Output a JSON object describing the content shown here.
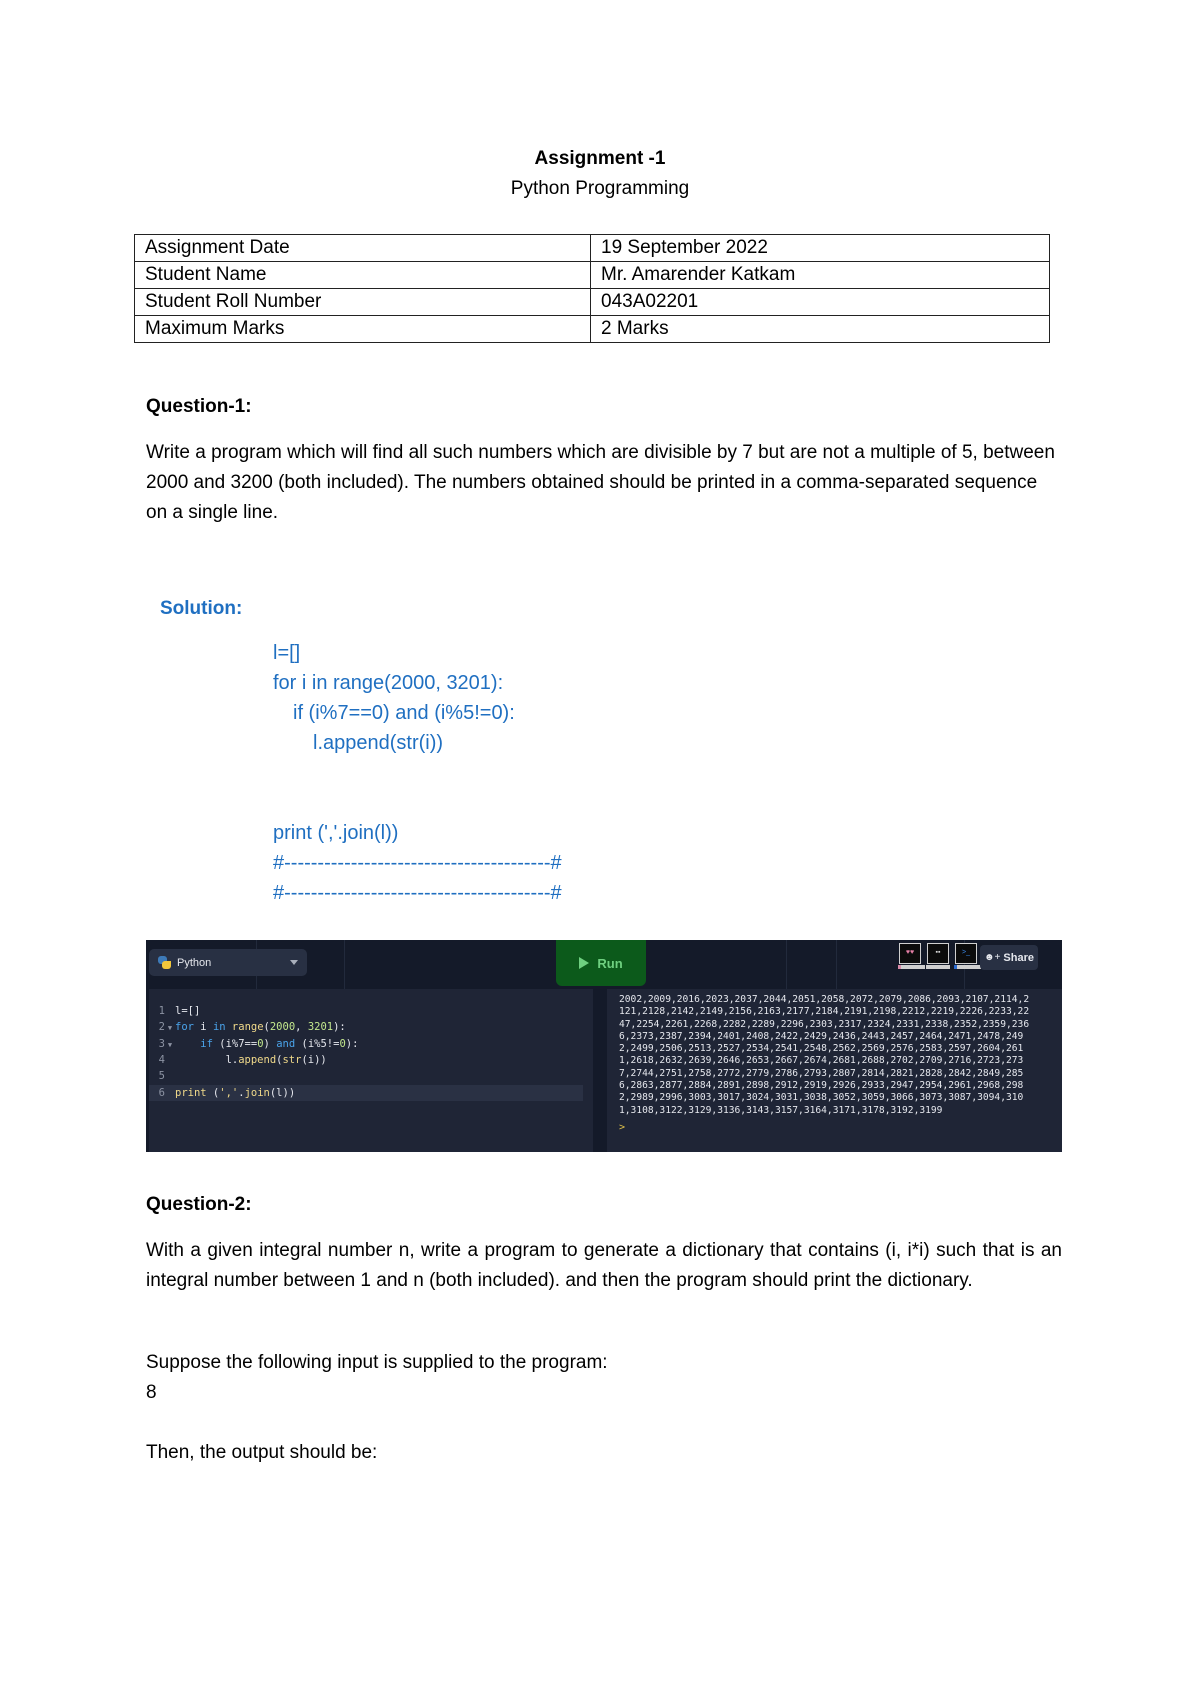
{
  "header": {
    "title": "Assignment -1",
    "subtitle": "Python Programming"
  },
  "info_table": [
    {
      "label": "Assignment Date",
      "value": "19 September 2022"
    },
    {
      "label": "Student Name",
      "value": "Mr. Amarender Katkam"
    },
    {
      "label": "Student Roll Number",
      "value": "043A02201"
    },
    {
      "label": "Maximum Marks",
      "value": "2 Marks"
    }
  ],
  "question1": {
    "heading": "Question-1:",
    "text": "Write a program which will find all such numbers which are divisible by 7 but are not a multiple of 5, between 2000 and 3200 (both included). The numbers obtained should be printed in a comma-separated sequence on a single line.",
    "solution_heading": "Solution:",
    "solution_lines": [
      "l=[]",
      "for i in range(2000, 3201):",
      "if (i%7==0) and (i%5!=0):",
      "l.append(str(i))",
      "print (','.join(l))",
      "#----------------------------------------#",
      "#----------------------------------------#"
    ]
  },
  "ide": {
    "language": "Python",
    "run_label": "Run",
    "share_label": "Share",
    "avatars": [
      {
        "name": "heart-eyes-avatar",
        "face": "♥♥"
      },
      {
        "name": "neutral-avatar",
        "face": "▪▪"
      },
      {
        "name": "prompt-avatar",
        "face": ">_"
      }
    ],
    "code": [
      {
        "n": "1",
        "fold": "",
        "tokens": [
          {
            "t": "l=[]",
            "c": "plain"
          }
        ]
      },
      {
        "n": "2",
        "fold": "▼",
        "tokens": [
          {
            "t": "for",
            "c": "kw"
          },
          {
            "t": " i ",
            "c": "plain"
          },
          {
            "t": "in",
            "c": "kw"
          },
          {
            "t": " ",
            "c": "plain"
          },
          {
            "t": "range",
            "c": "fn"
          },
          {
            "t": "(",
            "c": "op"
          },
          {
            "t": "2000",
            "c": "num"
          },
          {
            "t": ", ",
            "c": "op"
          },
          {
            "t": "3201",
            "c": "num"
          },
          {
            "t": "):",
            "c": "op"
          }
        ]
      },
      {
        "n": "3",
        "fold": "▼",
        "tokens": [
          {
            "t": "    ",
            "c": "plain"
          },
          {
            "t": "if",
            "c": "kw"
          },
          {
            "t": " (i%7==",
            "c": "plain"
          },
          {
            "t": "0",
            "c": "num"
          },
          {
            "t": ") ",
            "c": "plain"
          },
          {
            "t": "and",
            "c": "kw"
          },
          {
            "t": " (i%5!=",
            "c": "plain"
          },
          {
            "t": "0",
            "c": "num"
          },
          {
            "t": "):",
            "c": "plain"
          }
        ]
      },
      {
        "n": "4",
        "fold": "",
        "tokens": [
          {
            "t": "        l.",
            "c": "plain"
          },
          {
            "t": "append",
            "c": "fn"
          },
          {
            "t": "(",
            "c": "plain"
          },
          {
            "t": "str",
            "c": "fn"
          },
          {
            "t": "(i))",
            "c": "plain"
          }
        ]
      },
      {
        "n": "5",
        "fold": "",
        "tokens": []
      },
      {
        "n": "6",
        "fold": "",
        "tokens": [
          {
            "t": "print",
            "c": "fn"
          },
          {
            "t": " (",
            "c": "plain"
          },
          {
            "t": "','",
            "c": "str"
          },
          {
            "t": ".",
            "c": "plain"
          },
          {
            "t": "join",
            "c": "fn"
          },
          {
            "t": "(l))",
            "c": "plain"
          }
        ]
      }
    ],
    "output": "2002,2009,2016,2023,2037,2044,2051,2058,2072,2079,2086,2093,2107,2114,2121,2128,2142,2149,2156,2163,2177,2184,2191,2198,2212,2219,2226,2233,2247,2254,2261,2268,2282,2289,2296,2303,2317,2324,2331,2338,2352,2359,2366,2373,2387,2394,2401,2408,2422,2429,2436,2443,2457,2464,2471,2478,2492,2499,2506,2513,2527,2534,2541,2548,2562,2569,2576,2583,2597,2604,2611,2618,2632,2639,2646,2653,2667,2674,2681,2688,2702,2709,2716,2723,2737,2744,2751,2758,2772,2779,2786,2793,2807,2814,2821,2828,2842,2849,2856,2863,2877,2884,2891,2898,2912,2919,2926,2933,2947,2954,2961,2968,2982,2989,2996,3003,3017,3024,3031,3038,3052,3059,3066,3073,3087,3094,3101,3108,3122,3129,3136,3143,3157,3164,3171,3178,3192,3199",
    "prompt": ">"
  },
  "question2": {
    "heading": "Question-2:",
    "text": "With a given integral number n, write a program to generate a dictionary that contains (i, i*i) such that is an integral number between 1 and n (both included). and then the program should print the dictionary.",
    "input_intro": "Suppose the following input is supplied to the program:",
    "input_value": "8",
    "output_intro": "Then, the output should be:"
  }
}
